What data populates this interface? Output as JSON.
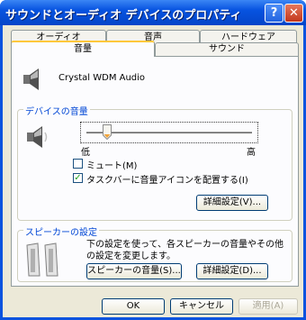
{
  "window": {
    "title": "サウンドとオーディオ デバイスのプロパティ"
  },
  "titlebar_buttons": {
    "help": "?",
    "close": "✕"
  },
  "tabs": {
    "row_back": [
      "オーディオ",
      "音声",
      "ハードウェア"
    ],
    "row_front": [
      "音量",
      "サウンド"
    ]
  },
  "device": {
    "name": "Crystal WDM Audio"
  },
  "device_volume": {
    "group_label": "デバイスの音量",
    "slider_low": "低",
    "slider_high": "高",
    "slider_level": 0.1,
    "mute_label": "ミュート(M)",
    "mute_checked": false,
    "mute_mark": "",
    "taskbar_label": "タスクバーに音量アイコンを配置する(I)",
    "taskbar_checked": true,
    "taskbar_mark": "✓",
    "advanced_button": "詳細設定(V)..."
  },
  "speaker": {
    "group_label": "スピーカーの設定",
    "description": "下の設定を使って、各スピーカーの音量やその他の設定を変更します。",
    "volume_button": "スピーカーの音量(S)...",
    "advanced_button": "詳細設定(D)..."
  },
  "footer": {
    "ok": "OK",
    "cancel": "キャンセル",
    "apply": "適用(A)"
  }
}
